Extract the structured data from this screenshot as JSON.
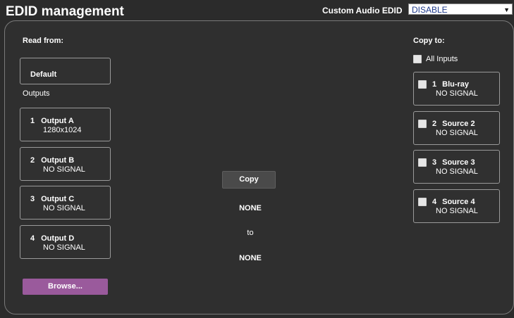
{
  "header": {
    "title": "EDID management",
    "custom_audio_label": "Custom Audio EDID",
    "custom_audio_value": "DISABLE"
  },
  "read_from": {
    "label": "Read from:",
    "default_label": "Default",
    "outputs_label": "Outputs",
    "outputs": [
      {
        "num": "1",
        "name": "Output A",
        "status": "1280x1024"
      },
      {
        "num": "2",
        "name": "Output B",
        "status": "NO SIGNAL"
      },
      {
        "num": "3",
        "name": "Output C",
        "status": "NO SIGNAL"
      },
      {
        "num": "4",
        "name": "Output D",
        "status": "NO SIGNAL"
      }
    ],
    "browse_label": "Browse..."
  },
  "center": {
    "copy_label": "Copy",
    "source": "NONE",
    "to_label": "to",
    "target": "NONE"
  },
  "copy_to": {
    "label": "Copy to:",
    "all_inputs_label": "All Inputs",
    "inputs": [
      {
        "num": "1",
        "name": "Blu-ray",
        "status": "NO SIGNAL"
      },
      {
        "num": "2",
        "name": "Source 2",
        "status": "NO SIGNAL"
      },
      {
        "num": "3",
        "name": "Source 3",
        "status": "NO SIGNAL"
      },
      {
        "num": "4",
        "name": "Source 4",
        "status": "NO SIGNAL"
      }
    ]
  },
  "colors": {
    "background": "#2b2b2b",
    "browse_button": "#9a5a9c",
    "dropdown_text": "#1f3a8a"
  }
}
